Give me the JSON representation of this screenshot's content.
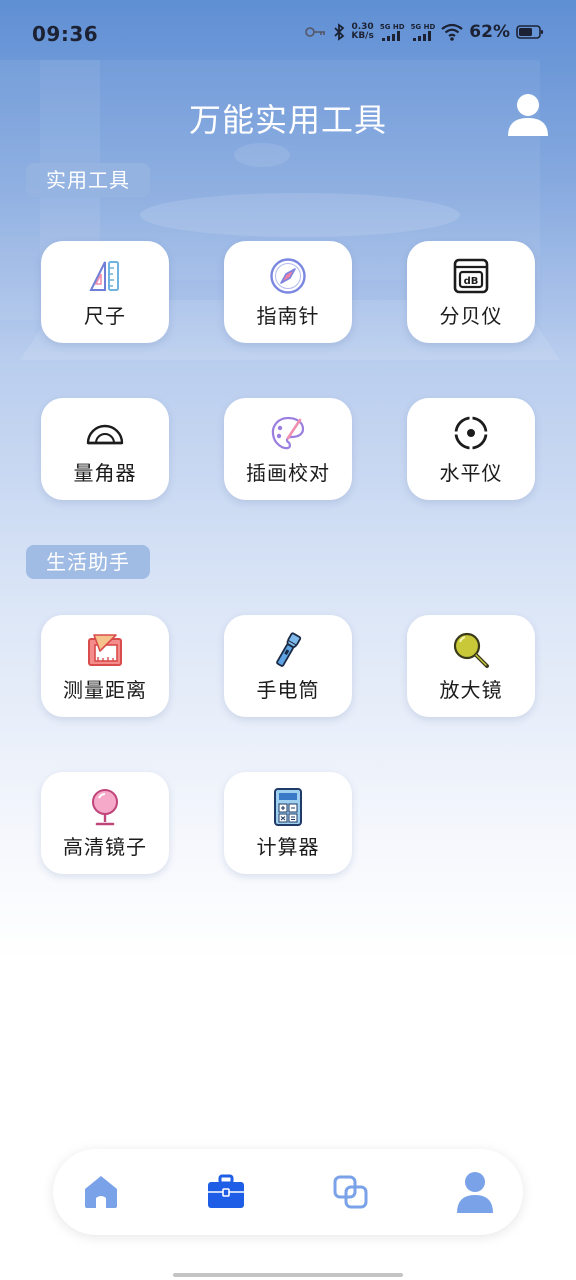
{
  "status_bar": {
    "time": "09:36",
    "net_speed_value": "0.30",
    "net_speed_unit": "KB/s",
    "sim1_label": "5G HD",
    "sim2_label": "5G HD",
    "battery_percent": "62%"
  },
  "header": {
    "title": "万能实用工具"
  },
  "sections": {
    "tools": {
      "label": "实用工具",
      "items": [
        {
          "label": "尺子",
          "icon": "ruler-icon"
        },
        {
          "label": "指南针",
          "icon": "compass-icon"
        },
        {
          "label": "分贝仪",
          "icon": "decibel-meter-icon"
        },
        {
          "label": "量角器",
          "icon": "protractor-icon"
        },
        {
          "label": "插画校对",
          "icon": "palette-icon"
        },
        {
          "label": "水平仪",
          "icon": "level-icon"
        }
      ]
    },
    "life": {
      "label": "生活助手",
      "items": [
        {
          "label": "测量距离",
          "icon": "distance-measure-icon"
        },
        {
          "label": "手电筒",
          "icon": "flashlight-icon"
        },
        {
          "label": "放大镜",
          "icon": "magnifier-icon"
        },
        {
          "label": "高清镜子",
          "icon": "mirror-icon"
        },
        {
          "label": "计算器",
          "icon": "calculator-icon"
        }
      ]
    }
  },
  "bottom_nav": {
    "items": [
      {
        "icon": "home-icon",
        "active": false
      },
      {
        "icon": "toolbox-icon",
        "active": true
      },
      {
        "icon": "overlap-squares-icon",
        "active": false
      },
      {
        "icon": "user-icon",
        "active": false
      }
    ]
  },
  "colors": {
    "accent_blue": "#1e5ee6",
    "nav_inactive": "#7aa2e8",
    "section_label_bg": "#96b4e1"
  }
}
